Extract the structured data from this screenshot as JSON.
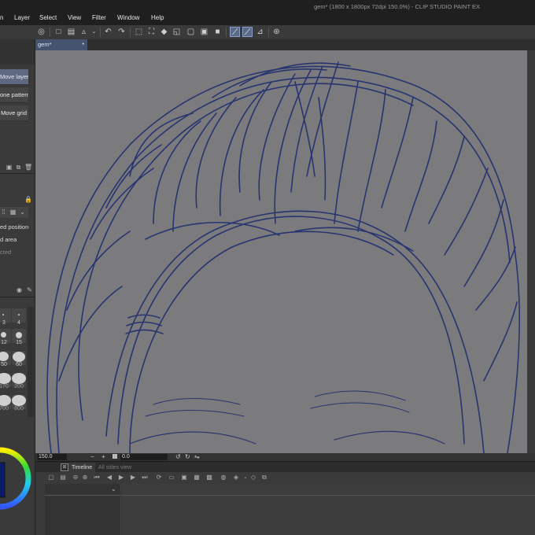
{
  "window": {
    "title": "gem* (1800 x 1800px 72dpi 150.0%)  - CLIP STUDIO PAINT EX"
  },
  "menu": {
    "items": [
      "n",
      "Layer",
      "Select",
      "View",
      "Filter",
      "Window",
      "Help"
    ]
  },
  "toolbar": {
    "icons": [
      "clip-studio-icon",
      "new-file-icon",
      "open-file-icon",
      "save-icon",
      "undo-icon",
      "redo-icon",
      "selection-icon",
      "pen-pressure-icon",
      "ruler-snap-icon"
    ]
  },
  "canvas_tab": {
    "label": "gem*",
    "dot": "•"
  },
  "sub_tools": [
    {
      "label": "Move layer",
      "selected": true
    },
    {
      "label": "one pattern",
      "selected": false
    },
    {
      "label": "Move grid",
      "selected": false
    }
  ],
  "tool_property": {
    "labels": [
      "ed position",
      "d area",
      "cted"
    ]
  },
  "brush_size": {
    "values": [
      "3",
      "4",
      "12",
      "15",
      "50",
      "60",
      "170",
      "200",
      "700",
      "800"
    ]
  },
  "navigator": {
    "zoom": "150.0",
    "angle": "0.0"
  },
  "timeline": {
    "tab_label": "Timeline",
    "second_tab_label": "All sides view"
  },
  "colors": {
    "canvas_bg": "#7b7b7d",
    "stroke": "#1f2d6e",
    "accent": "#5f6a82"
  }
}
